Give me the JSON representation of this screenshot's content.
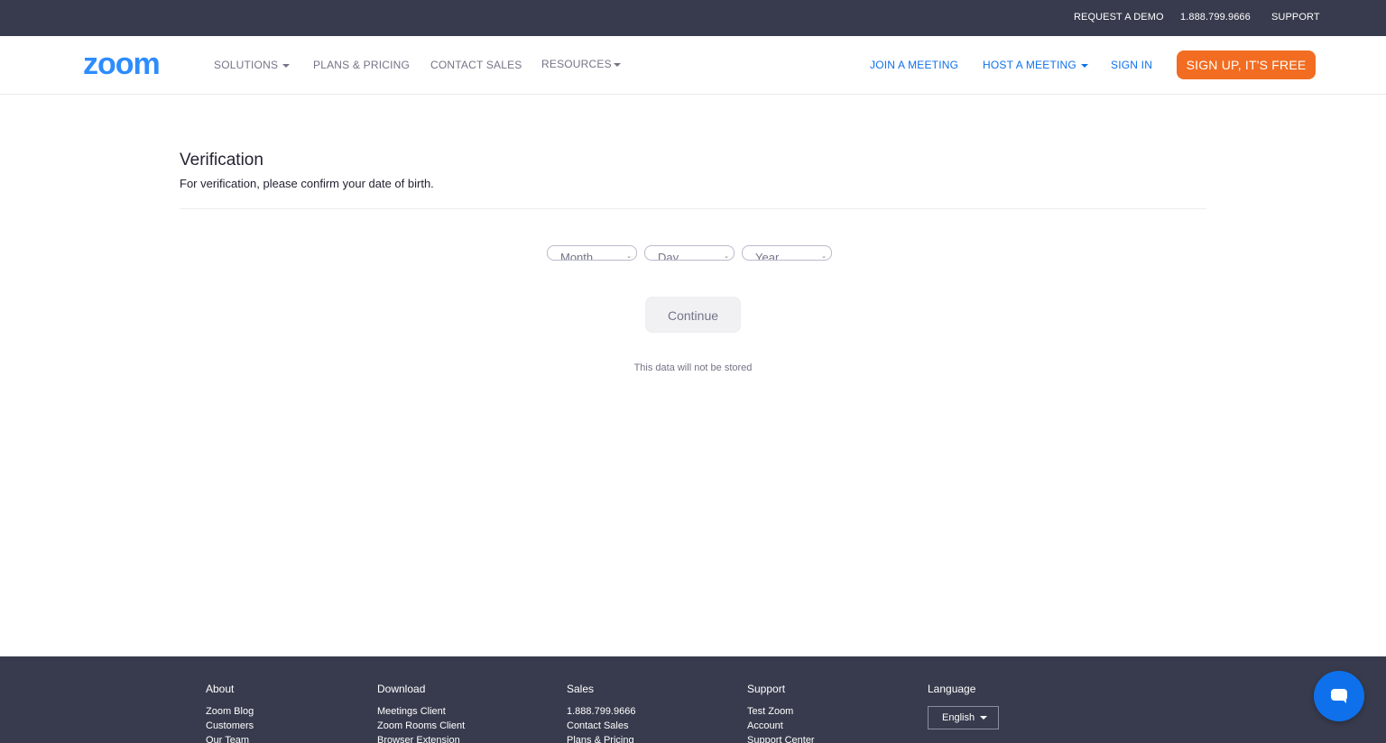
{
  "topbar": {
    "request_demo": "REQUEST A DEMO",
    "phone": "1.888.799.9666",
    "support": "SUPPORT"
  },
  "nav": {
    "logo": "zoom",
    "solutions": "SOLUTIONS",
    "plans_pricing": "PLANS & PRICING",
    "contact_sales": "CONTACT SALES",
    "resources": "RESOURCES",
    "join_meeting": "JOIN A MEETING",
    "host_meeting": "HOST A MEETING",
    "sign_in": "SIGN IN",
    "sign_up": "SIGN UP, IT'S FREE"
  },
  "main": {
    "title": "Verification",
    "subtitle": "For verification, please confirm your date of birth.",
    "month_placeholder": "Month",
    "day_placeholder": "Day",
    "year_placeholder": "Year",
    "continue_label": "Continue",
    "note": "This data will not be stored"
  },
  "footer": {
    "about": {
      "heading": "About",
      "links": [
        "Zoom Blog",
        "Customers",
        "Our Team"
      ]
    },
    "download": {
      "heading": "Download",
      "links": [
        "Meetings Client",
        "Zoom Rooms Client",
        "Browser Extension"
      ]
    },
    "sales": {
      "heading": "Sales",
      "links": [
        "1.888.799.9666",
        "Contact Sales",
        "Plans & Pricing"
      ]
    },
    "support": {
      "heading": "Support",
      "links": [
        "Test Zoom",
        "Account",
        "Support Center"
      ]
    },
    "language": {
      "heading": "Language",
      "selected": "English"
    }
  },
  "colors": {
    "brand_blue": "#2d8cff",
    "link_blue": "#0e71eb",
    "signup_orange": "#f26d21",
    "dark_bar": "#383b4d"
  },
  "icons": {
    "chat": "chat-bubble-icon"
  }
}
